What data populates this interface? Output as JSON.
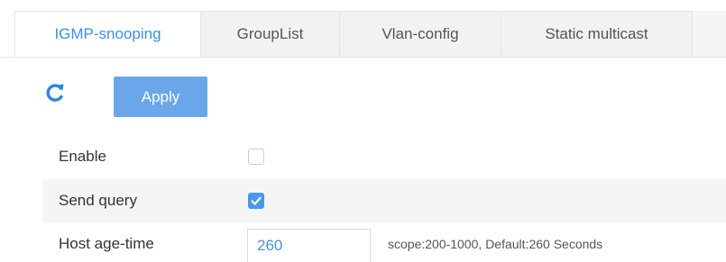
{
  "tabs": [
    {
      "label": "IGMP-snooping",
      "active": true
    },
    {
      "label": "GroupList",
      "active": false
    },
    {
      "label": "Vlan-config",
      "active": false
    },
    {
      "label": "Static multicast",
      "active": false
    }
  ],
  "toolbar": {
    "refresh_icon": "refresh-icon",
    "apply_label": "Apply"
  },
  "form": {
    "enable": {
      "label": "Enable",
      "checked": false
    },
    "send_query": {
      "label": "Send query",
      "checked": true
    },
    "host_age_time": {
      "label": "Host age-time",
      "value": "260",
      "hint": "scope:200-1000, Default:260 Seconds"
    }
  },
  "colors": {
    "accent": "#3d8fe0",
    "button": "#6aa7ea",
    "checkbox_checked": "#4a98e9"
  }
}
